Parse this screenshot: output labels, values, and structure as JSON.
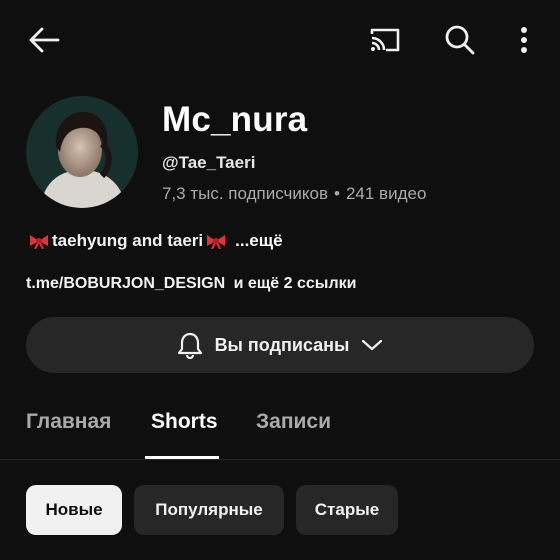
{
  "topbar": {
    "back_icon": "arrow-left-icon",
    "cast_icon": "cast-icon",
    "search_icon": "search-icon",
    "more_icon": "more-vertical-icon"
  },
  "channel": {
    "name": "Mc_nura",
    "handle": "@Tae_Taeri",
    "subscribers": "7,3 тыс. подписчиков",
    "separator": "•",
    "videos": "241 видео",
    "description_text": "taehyung and taeri",
    "description_more": "...ещё",
    "link_url": "t.me/BOBURJON_DESIGN",
    "link_extra": "и ещё 2 ссылки",
    "bow_icon": "red-bow-emoji-icon"
  },
  "subscribe": {
    "label": "Вы подписаны",
    "bell_icon": "bell-icon",
    "chevron_icon": "chevron-down-icon",
    "background": "#272727"
  },
  "tabs": [
    {
      "label": "Главная",
      "active": false
    },
    {
      "label": "Shorts",
      "active": true
    },
    {
      "label": "Записи",
      "active": false
    }
  ],
  "chips": [
    {
      "label": "Новые",
      "selected": true
    },
    {
      "label": "Популярные",
      "selected": false
    },
    {
      "label": "Старые",
      "selected": false
    }
  ],
  "colors": {
    "background": "#0f0f0f",
    "surface": "#272727",
    "text_primary": "#f1f1f1",
    "text_secondary": "#aaaaaa",
    "bow": "#e0343a"
  }
}
